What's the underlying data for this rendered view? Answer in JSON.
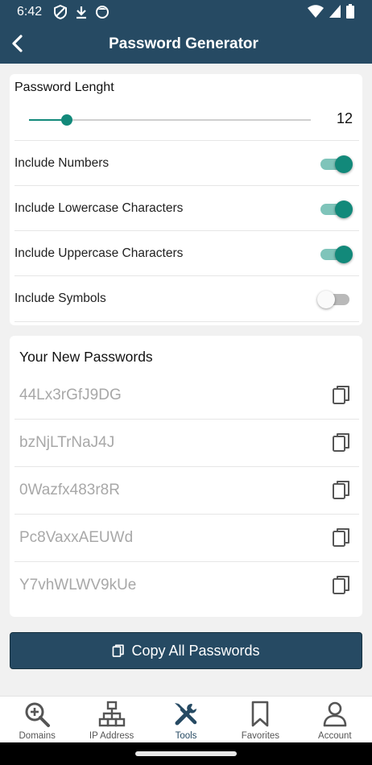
{
  "status_bar": {
    "time": "6:42",
    "icons": [
      "vpn-shield-icon",
      "download-icon",
      "face-icon",
      "wifi-icon",
      "signal-icon",
      "battery-icon"
    ]
  },
  "app_bar": {
    "title": "Password Generator",
    "back_icon": "back-arrow-icon"
  },
  "settings": {
    "length_label": "Password Lenght",
    "length_value": "12",
    "slider": {
      "min": 4,
      "max": 64,
      "value": 12
    },
    "options": [
      {
        "label": "Include Numbers",
        "enabled": true
      },
      {
        "label": "Include Lowercase Characters",
        "enabled": true
      },
      {
        "label": "Include Uppercase Characters",
        "enabled": true
      },
      {
        "label": "Include Symbols",
        "enabled": false
      }
    ]
  },
  "passwords": {
    "title": "Your New Passwords",
    "items": [
      "44Lx3rGfJ9DG",
      "bzNjLTrNaJ4J",
      "0Wazfx483r8R",
      "Pc8VaxxAEUWd",
      "Y7vhWLWV9kUe"
    ],
    "copy_icon": "copy-icon"
  },
  "copy_all": {
    "label": "Copy All Passwords",
    "icon": "copy-icon"
  },
  "bottom_nav": {
    "items": [
      {
        "label": "Domains",
        "icon": "search-plus-icon",
        "active": false
      },
      {
        "label": "IP Address",
        "icon": "network-icon",
        "active": false
      },
      {
        "label": "Tools",
        "icon": "tools-icon",
        "active": true
      },
      {
        "label": "Favorites",
        "icon": "bookmark-icon",
        "active": false
      },
      {
        "label": "Account",
        "icon": "user-icon",
        "active": false
      }
    ]
  },
  "colors": {
    "primary": "#264a63",
    "accent": "#12897a",
    "accent_light": "#7fc4ba",
    "background": "#f1f1f1",
    "password_text": "#a8a8a8"
  }
}
